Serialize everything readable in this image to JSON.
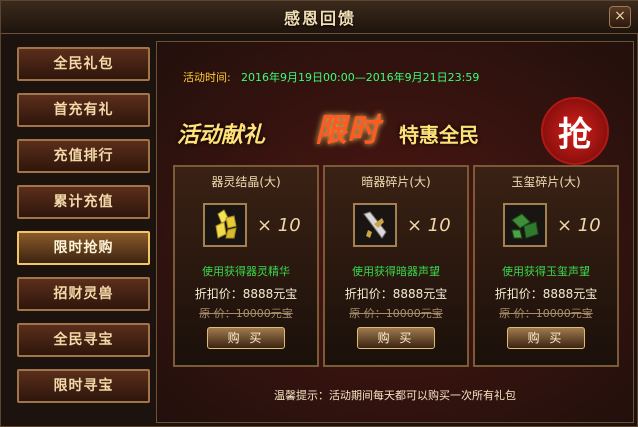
{
  "window": {
    "title": "感恩回馈",
    "close": "×"
  },
  "sidebar": {
    "items": [
      {
        "label": "全民礼包",
        "active": false
      },
      {
        "label": "首充有礼",
        "active": false
      },
      {
        "label": "充值排行",
        "active": false
      },
      {
        "label": "累计充值",
        "active": false
      },
      {
        "label": "限时抢购",
        "active": true
      },
      {
        "label": "招财灵兽",
        "active": false
      },
      {
        "label": "全民寻宝",
        "active": false
      },
      {
        "label": "限时寻宝",
        "active": false
      }
    ]
  },
  "event": {
    "time_label": "活动时间:",
    "time_value": "2016年9月19日00:00—2016年9月21日23:59",
    "banner": {
      "part1": "活动献礼",
      "part2": "限时",
      "part3": "特惠全民",
      "seal": "抢"
    }
  },
  "items": [
    {
      "name": "器灵结晶(大)",
      "icon": "crystal-icon",
      "quantity": "× 10",
      "desc": "使用获得器灵精华",
      "price": "折扣价：8888元宝",
      "original": "原 价：10000元宝",
      "button": "购 买"
    },
    {
      "name": "暗器碎片(大)",
      "icon": "dart-fragment-icon",
      "quantity": "× 10",
      "desc": "使用获得暗器声望",
      "price": "折扣价：8888元宝",
      "original": "原 价：10000元宝",
      "button": "购 买"
    },
    {
      "name": "玉玺碎片(大)",
      "icon": "jade-seal-fragment-icon",
      "quantity": "× 10",
      "desc": "使用获得玉玺声望",
      "price": "折扣价：8888元宝",
      "original": "原 价：10000元宝",
      "button": "购 买"
    }
  ],
  "footer": {
    "tip": "温馨提示：活动期间每天都可以购买一次所有礼包"
  },
  "colors": {
    "accent": "#f2c664",
    "highlight": "#ff5a22",
    "time": "#3aff7a",
    "desc": "#39d84c"
  }
}
